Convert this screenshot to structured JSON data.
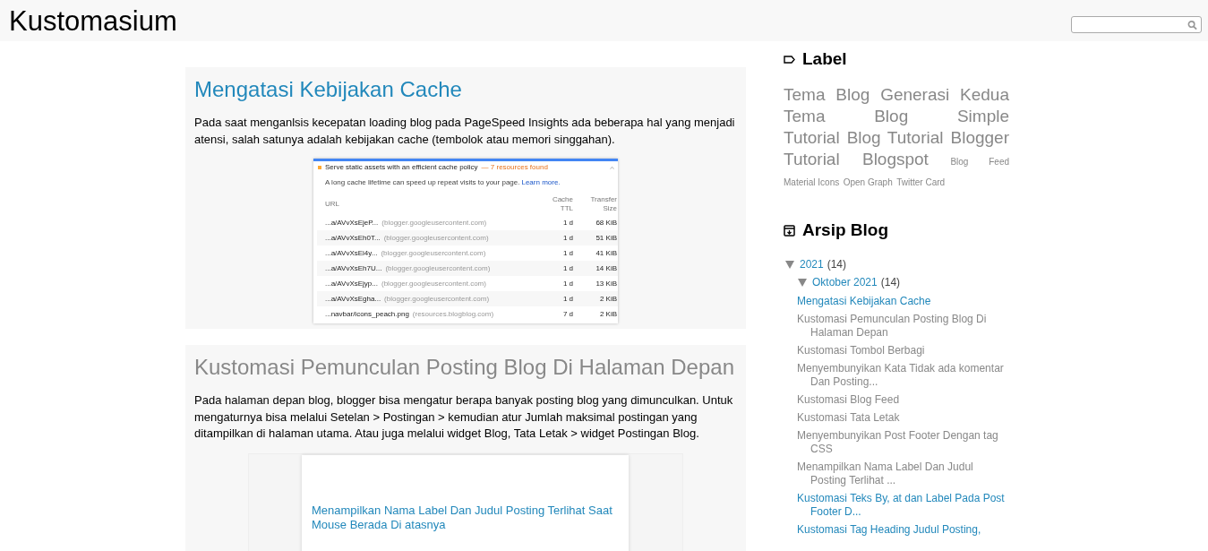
{
  "header": {
    "title": "Kustomasium"
  },
  "posts": [
    {
      "title": "Mengatasi Kebijakan Cache",
      "visited": false,
      "body": "Pada saat menganlsis kecepatan loading blog pada PageSpeed Insights ada beberapa hal yang menjadi atensi, salah satunya adalah kebijakan cache (tembolok atau memori singgahan).",
      "figure": {
        "kind": "audit",
        "heading": "Serve static assets with an efficient cache policy",
        "found": "— 7 resources found",
        "note": "A long cache lifetime can speed up repeat visits to your page.",
        "link": "Learn more.",
        "columns": [
          "URL",
          "Cache TTL",
          "Transfer Size"
        ],
        "rows": [
          {
            "url": "...a/AVvXsEjeP...",
            "host": "(blogger.googleusercontent.com)",
            "ttl": "1 d",
            "size": "68 KiB"
          },
          {
            "url": "...a/AVvXsEh0T...",
            "host": "(blogger.googleusercontent.com)",
            "ttl": "1 d",
            "size": "51 KiB"
          },
          {
            "url": "...a/AVvXsEi4y...",
            "host": "(blogger.googleusercontent.com)",
            "ttl": "1 d",
            "size": "41 KiB"
          },
          {
            "url": "...a/AVvXsEh7U...",
            "host": "(blogger.googleusercontent.com)",
            "ttl": "1 d",
            "size": "14 KiB"
          },
          {
            "url": "...a/AVvXsEjyp...",
            "host": "(blogger.googleusercontent.com)",
            "ttl": "1 d",
            "size": "13 KiB"
          },
          {
            "url": "...a/AVvXsEgha...",
            "host": "(blogger.googleusercontent.com)",
            "ttl": "1 d",
            "size": "2 KiB"
          },
          {
            "url": "...navbar/icons_peach.png",
            "host": "(resources.blogblog.com)",
            "ttl": "7 d",
            "size": "2 KiB"
          }
        ]
      }
    },
    {
      "title": "Kustomasi Pemunculan Posting Blog Di Halaman Depan",
      "visited": true,
      "body": "Pada halaman depan blog, blogger bisa mengatur berapa banyak posting blog yang dimunculkan. Untuk mengaturnya bisa melalui Setelan > Postingan > kemudian atur Jumlah maksimal postingan yang ditampilkan di halaman utama. Atau juga melalui widget Blog, Tata Letak > widget Postingan Blog.",
      "figure": {
        "kind": "page",
        "link": "Menampilkan Nama Label Dan Judul Posting Terlihat Saat Mouse Berada Di atasnya"
      }
    }
  ],
  "sidebar": {
    "labels": {
      "title": "Label",
      "items": [
        {
          "text": "Tema Blog Generasi Kedua",
          "kind": "large"
        },
        {
          "text": "Tema Blog Simple",
          "kind": "large"
        },
        {
          "text": "Tutorial Blog",
          "kind": "large"
        },
        {
          "text": "Tutorial Blogger",
          "kind": "large"
        },
        {
          "text": "Tutorial Blogspot",
          "kind": "large"
        },
        {
          "text": "Blog Feed",
          "kind": "small"
        },
        {
          "text": "Material Icons",
          "kind": "small"
        },
        {
          "text": "Open Graph",
          "kind": "small"
        },
        {
          "text": "Twitter Card",
          "kind": "small"
        }
      ]
    },
    "archive": {
      "title": "Arsip Blog",
      "items": [
        {
          "label": "2021",
          "count": "(14)",
          "expanded": true,
          "children": [
            {
              "label": "Oktober 2021",
              "count": "(14)",
              "expanded": true,
              "children": [
                {
                  "label": "Mengatasi Kebijakan Cache",
                  "visited": false
                },
                {
                  "label": "Kustomasi Pemunculan Posting Blog Di Halaman Depan",
                  "visited": true
                },
                {
                  "label": "Kustomasi Tombol Berbagi",
                  "visited": true
                },
                {
                  "label": "Menyembunyikan Kata Tidak ada komentar Dan Posting...",
                  "visited": true
                },
                {
                  "label": "Kustomasi Blog Feed",
                  "visited": true
                },
                {
                  "label": "Kustomasi Tata Letak",
                  "visited": true
                },
                {
                  "label": "Menyembunyikan Post Footer Dengan tag CSS",
                  "visited": true
                },
                {
                  "label": "Menampilkan Nama Label Dan Judul Posting Terlihat ...",
                  "visited": true
                },
                {
                  "label": "Kustomasi Teks By, at dan Label Pada Post Footer D...",
                  "visited": false
                },
                {
                  "label": "Kustomasi Tag Heading Judul Posting,",
                  "visited": false
                }
              ]
            }
          ]
        }
      ]
    }
  }
}
